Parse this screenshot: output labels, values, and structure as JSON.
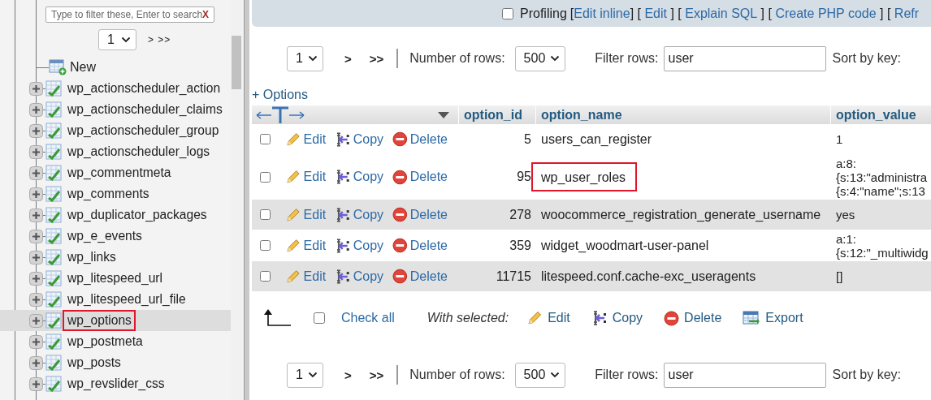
{
  "sidebar": {
    "filter": {
      "placeholder": "Type to filter these, Enter to search",
      "clear": "X"
    },
    "pager": {
      "page": "1",
      "next": "> >>"
    },
    "new_item": "New",
    "tables": [
      {
        "name": "wp_actionscheduler_action",
        "selected": false,
        "highlighted": false
      },
      {
        "name": "wp_actionscheduler_claims",
        "selected": false,
        "highlighted": false
      },
      {
        "name": "wp_actionscheduler_group",
        "selected": false,
        "highlighted": false
      },
      {
        "name": "wp_actionscheduler_logs",
        "selected": false,
        "highlighted": false
      },
      {
        "name": "wp_commentmeta",
        "selected": false,
        "highlighted": false
      },
      {
        "name": "wp_comments",
        "selected": false,
        "highlighted": false
      },
      {
        "name": "wp_duplicator_packages",
        "selected": false,
        "highlighted": false
      },
      {
        "name": "wp_e_events",
        "selected": false,
        "highlighted": false
      },
      {
        "name": "wp_links",
        "selected": false,
        "highlighted": false
      },
      {
        "name": "wp_litespeed_url",
        "selected": false,
        "highlighted": false
      },
      {
        "name": "wp_litespeed_url_file",
        "selected": false,
        "highlighted": false
      },
      {
        "name": "wp_options",
        "selected": true,
        "highlighted": true
      },
      {
        "name": "wp_postmeta",
        "selected": false,
        "highlighted": false
      },
      {
        "name": "wp_posts",
        "selected": false,
        "highlighted": false
      },
      {
        "name": "wp_revslider_css",
        "selected": false,
        "highlighted": false
      }
    ]
  },
  "main": {
    "profiling": {
      "label": "Profiling",
      "checked": false,
      "items": [
        {
          "kind": "text",
          "text": "["
        },
        {
          "kind": "link",
          "text": "Edit inline"
        },
        {
          "kind": "text",
          "text": "] [ "
        },
        {
          "kind": "link",
          "text": "Edit"
        },
        {
          "kind": "text",
          "text": " ] [ "
        },
        {
          "kind": "link",
          "text": "Explain SQL"
        },
        {
          "kind": "text",
          "text": " ] [ "
        },
        {
          "kind": "link",
          "text": "Create PHP code"
        },
        {
          "kind": "text",
          "text": " ] [ "
        },
        {
          "kind": "link",
          "text": "Refr"
        }
      ]
    },
    "nav_top": {
      "page": "1",
      "next": ">",
      "last": ">>",
      "rows_label": "Number of rows:",
      "rows_value": "500",
      "filter_label": "Filter rows:",
      "filter_value": "user",
      "sort_label": "Sort by key:"
    },
    "options_link": "+ Options",
    "table": {
      "columns": [
        "option_id",
        "option_name",
        "option_value"
      ],
      "rows": [
        {
          "checked": false,
          "shaded": false,
          "actions": [
            {
              "kind": "edit",
              "label": "Edit"
            },
            {
              "kind": "copy",
              "label": "Copy"
            },
            {
              "kind": "delete",
              "label": "Delete"
            }
          ],
          "option_id": "5",
          "option_name": "users_can_register",
          "highlighted": false,
          "option_value": [
            "1"
          ]
        },
        {
          "checked": false,
          "shaded": false,
          "actions": [
            {
              "kind": "edit",
              "label": "Edit"
            },
            {
              "kind": "copy",
              "label": "Copy"
            },
            {
              "kind": "delete",
              "label": "Delete"
            }
          ],
          "option_id": "95",
          "option_name": "wp_user_roles",
          "highlighted": true,
          "option_value": [
            "a:8:",
            "{s:13:\"administra",
            "{s:4:\"name\";s:13"
          ]
        },
        {
          "checked": false,
          "shaded": true,
          "actions": [
            {
              "kind": "edit",
              "label": "Edit"
            },
            {
              "kind": "copy",
              "label": "Copy"
            },
            {
              "kind": "delete",
              "label": "Delete"
            }
          ],
          "option_id": "278",
          "option_name": "woocommerce_registration_generate_username",
          "highlighted": false,
          "option_value": [
            "yes"
          ]
        },
        {
          "checked": false,
          "shaded": false,
          "actions": [
            {
              "kind": "edit",
              "label": "Edit"
            },
            {
              "kind": "copy",
              "label": "Copy"
            },
            {
              "kind": "delete",
              "label": "Delete"
            }
          ],
          "option_id": "359",
          "option_name": "widget_woodmart-user-panel",
          "highlighted": false,
          "option_value": [
            "a:1:",
            "{s:12:\"_multiwidg"
          ]
        },
        {
          "checked": false,
          "shaded": true,
          "actions": [
            {
              "kind": "edit",
              "label": "Edit"
            },
            {
              "kind": "copy",
              "label": "Copy"
            },
            {
              "kind": "delete",
              "label": "Delete"
            }
          ],
          "option_id": "11715",
          "option_name": "litespeed.conf.cache-exc_useragents",
          "highlighted": false,
          "option_value": [
            "[]"
          ]
        }
      ]
    },
    "bulk": {
      "check_all": {
        "label": "Check all",
        "checked": false
      },
      "with_selected": "With selected:",
      "actions": [
        {
          "kind": "edit",
          "label": "Edit"
        },
        {
          "kind": "copy",
          "label": "Copy"
        },
        {
          "kind": "delete",
          "label": "Delete"
        },
        {
          "kind": "export",
          "label": "Export"
        }
      ]
    },
    "nav_bottom": {
      "page": "1",
      "next": ">",
      "last": ">>",
      "rows_label": "Number of rows:",
      "rows_value": "500",
      "filter_label": "Filter rows:",
      "filter_value": "user",
      "sort_label": "Sort by key:"
    }
  }
}
